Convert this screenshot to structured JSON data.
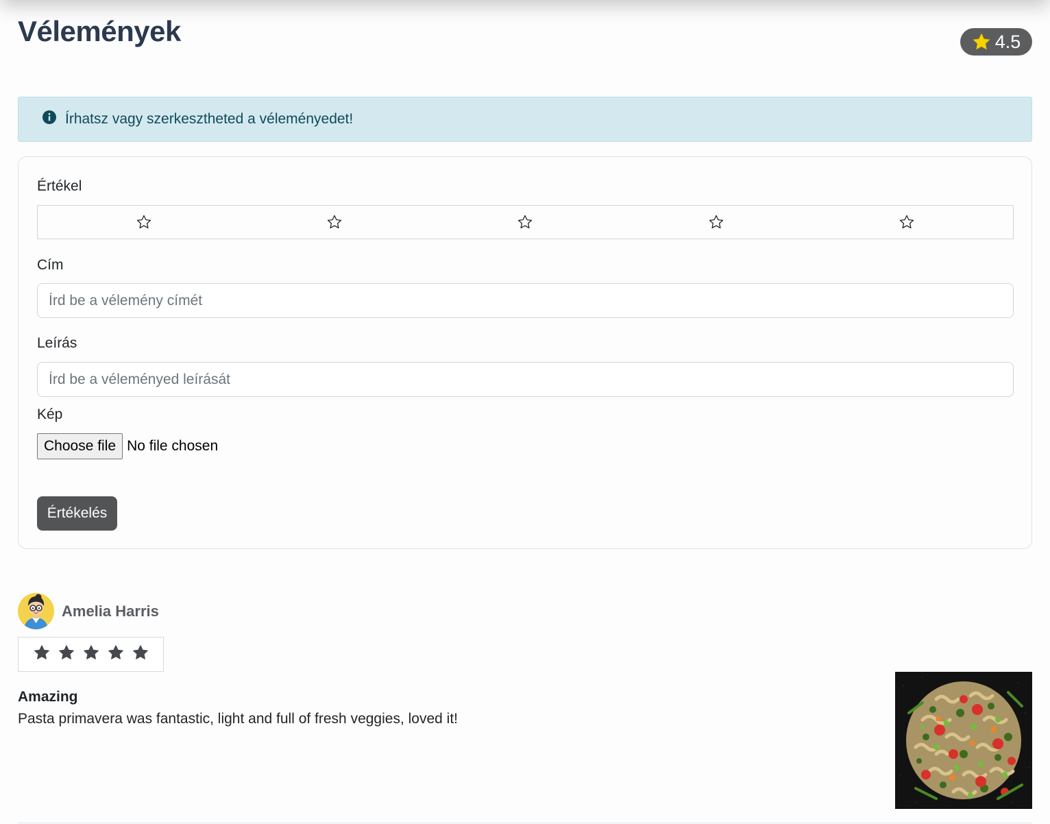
{
  "header": {
    "title": "Vélemények",
    "average_rating": "4.5"
  },
  "alert": {
    "text": "Írhatsz vagy szerkesztheted a véleményedet!"
  },
  "form": {
    "rating_label": "Értékel",
    "rating_stars": 5,
    "rating_value": 0,
    "title_label": "Cím",
    "title_placeholder": "Írd be a vélemény címét",
    "description_label": "Leírás",
    "description_placeholder": "Írd be a véleményed leírását",
    "image_label": "Kép",
    "file_button": "Choose file",
    "file_status": "No file chosen",
    "submit_label": "Értékelés"
  },
  "reviews": [
    {
      "author": "Amelia Harris",
      "stars": 5,
      "title": "Amazing",
      "body": "Pasta primavera was fantastic, light and full of fresh veggies, loved it!",
      "image_alt": "pasta-primavera-photo"
    }
  ],
  "colors": {
    "title": "#2c3a4f",
    "alert_bg": "#d4e9ef",
    "alert_text": "#0f4a5a",
    "button_bg": "#525456",
    "pill_bg": "#5b5d5f",
    "star_gold": "#f6d200"
  }
}
